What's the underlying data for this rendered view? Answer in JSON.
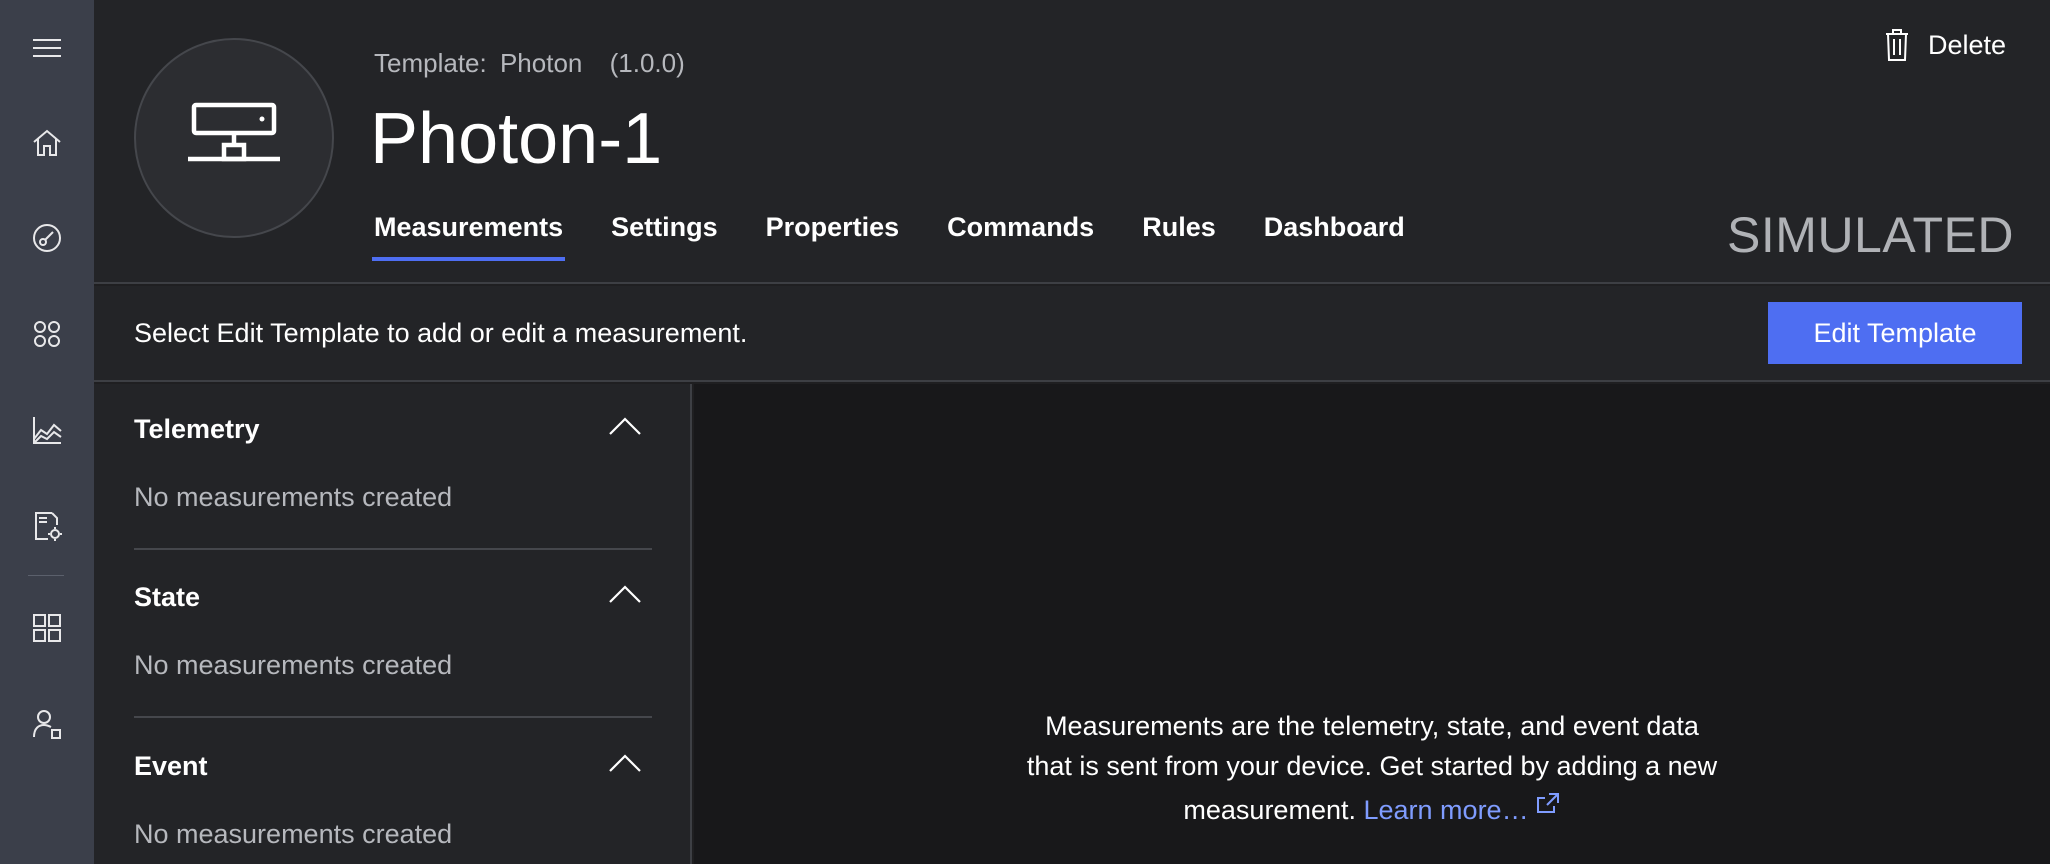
{
  "rail": {
    "items": [
      {
        "name": "menu",
        "icon": "hamburger-menu-icon"
      },
      {
        "name": "home",
        "icon": "home-icon"
      },
      {
        "name": "device-explorer",
        "icon": "gauge-icon"
      },
      {
        "name": "device-sets",
        "icon": "device-sets-icon"
      },
      {
        "name": "analytics",
        "icon": "analytics-chart-icon"
      },
      {
        "name": "jobs",
        "icon": "document-gear-icon"
      },
      {
        "name": "app-builder",
        "icon": "grid-icon"
      },
      {
        "name": "administration",
        "icon": "user-admin-icon"
      }
    ]
  },
  "header": {
    "template_label": "Template:",
    "template_name": "Photon",
    "template_version": "(1.0.0)",
    "device_name": "Photon-1",
    "delete_label": "Delete",
    "status_badge": "SIMULATED",
    "tabs": [
      {
        "label": "Measurements",
        "active": true
      },
      {
        "label": "Settings",
        "active": false
      },
      {
        "label": "Properties",
        "active": false
      },
      {
        "label": "Commands",
        "active": false
      },
      {
        "label": "Rules",
        "active": false
      },
      {
        "label": "Dashboard",
        "active": false
      }
    ]
  },
  "infobar": {
    "message": "Select Edit Template to add or edit a measurement.",
    "edit_button_label": "Edit Template"
  },
  "sections": [
    {
      "title": "Telemetry",
      "empty_text": "No measurements created"
    },
    {
      "title": "State",
      "empty_text": "No measurements created"
    },
    {
      "title": "Event",
      "empty_text": "No measurements created"
    }
  ],
  "main": {
    "message": "Measurements are the telemetry, state, and event data that is sent from your device. Get started by adding a new measurement.",
    "learn_more": "Learn more…"
  },
  "colors": {
    "accent": "#4e6ef2",
    "link": "#7f9cff",
    "rail": "#3b3f4a",
    "panel": "#232427",
    "main_bg": "#18181a"
  }
}
